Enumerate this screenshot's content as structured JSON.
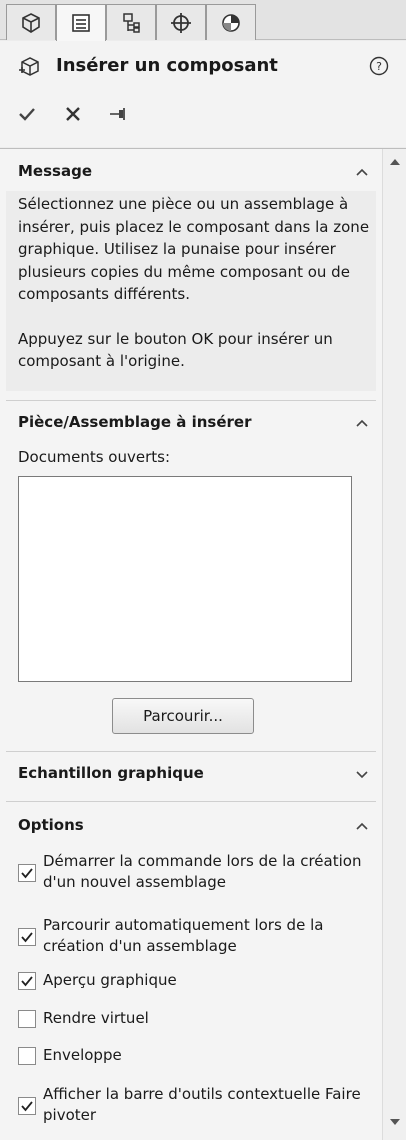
{
  "tabs": [
    {
      "icon": "feature-manager-icon"
    },
    {
      "icon": "property-manager-icon",
      "active": true
    },
    {
      "icon": "configuration-manager-icon"
    },
    {
      "icon": "dimxpert-manager-icon"
    },
    {
      "icon": "display-manager-icon"
    }
  ],
  "header": {
    "title": "Insérer un composant",
    "title_icon": "insert-component-icon",
    "help_icon": "help-icon",
    "actions": [
      {
        "name": "ok",
        "icon": "checkmark-icon"
      },
      {
        "name": "cancel",
        "icon": "close-icon"
      },
      {
        "name": "keep-visible",
        "icon": "pushpin-icon"
      }
    ]
  },
  "message": {
    "title": "Message",
    "paragraph1": "Sélectionnez une pièce ou un assemblage à insérer, puis placez le composant dans la zone graphique. Utilisez la punaise pour insérer plusieurs copies du même composant ou de composants différents.",
    "paragraph2": "Appuyez sur le bouton OK pour insérer un composant à l'origine."
  },
  "part_assembly": {
    "title": "Pièce/Assemblage à insérer",
    "open_docs_label": "Documents ouverts:",
    "open_docs": [],
    "browse_label": "Parcourir..."
  },
  "thumbnail": {
    "title": "Echantillon graphique"
  },
  "options": {
    "title": "Options",
    "items": [
      {
        "label": "Démarrer la commande lors de la création d'un nouvel assemblage",
        "checked": true
      },
      {
        "label": "Parcourir automatiquement lors de la création d'un assemblage",
        "checked": true
      },
      {
        "label": "Aperçu graphique",
        "checked": true
      },
      {
        "label": "Rendre virtuel",
        "checked": false
      },
      {
        "label": "Enveloppe",
        "checked": false
      },
      {
        "label": "Afficher la barre d'outils contextuelle Faire pivoter",
        "checked": true
      }
    ]
  }
}
